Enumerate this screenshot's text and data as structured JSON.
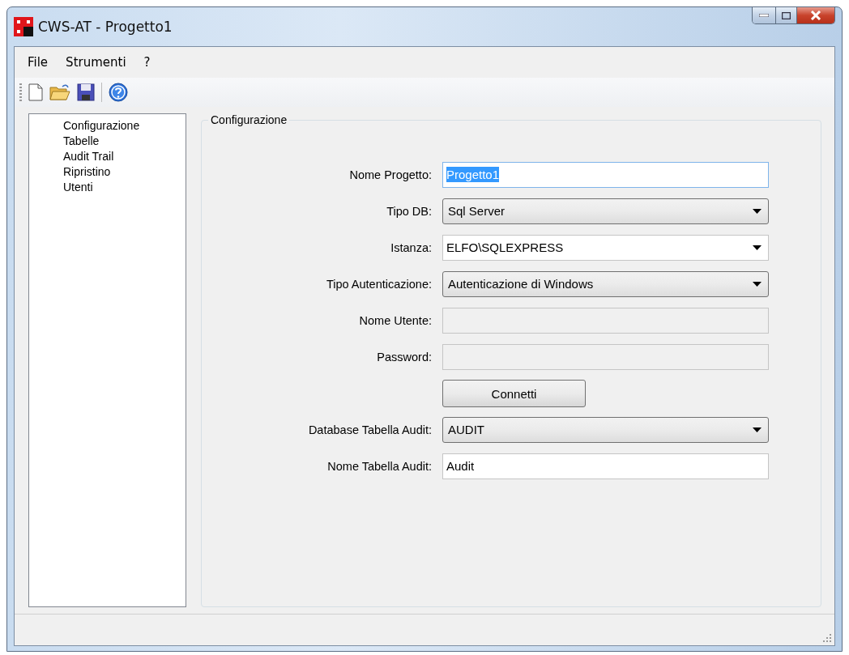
{
  "window": {
    "title": "CWS-AT - Progetto1"
  },
  "menu": [
    "File",
    "Strumenti",
    "?"
  ],
  "toolbar": [
    {
      "kind": "new"
    },
    {
      "kind": "open"
    },
    {
      "kind": "save"
    },
    {
      "kind": "separator"
    },
    {
      "kind": "help"
    }
  ],
  "sidebar": {
    "items": [
      {
        "label": "Configurazione",
        "selected": false
      },
      {
        "label": "Tabelle",
        "selected": false
      },
      {
        "label": "Audit Trail",
        "selected": false
      },
      {
        "label": "Ripristino",
        "selected": false
      },
      {
        "label": "Utenti",
        "selected": false
      }
    ]
  },
  "group": {
    "title": "Configurazione",
    "rows": [
      {
        "kind": "text",
        "label": "Nome Progetto:",
        "value": "Progetto1",
        "highlighted": true,
        "disabled": false
      },
      {
        "kind": "dropdown",
        "label": "Tipo DB:",
        "value": "Sql Server"
      },
      {
        "kind": "combo",
        "label": "Istanza:",
        "value": "ELFO\\SQLEXPRESS"
      },
      {
        "kind": "dropdown",
        "label": "Tipo Autenticazione:",
        "value": "Autenticazione di Windows"
      },
      {
        "kind": "text",
        "label": "Nome Utente:",
        "highlighted": false,
        "disabled": true
      },
      {
        "kind": "text",
        "label": "Password:",
        "highlighted": false,
        "disabled": true
      },
      {
        "kind": "button",
        "value": "Connetti"
      },
      {
        "kind": "dropdown",
        "label": "Database Tabella Audit:",
        "value": "AUDIT"
      },
      {
        "kind": "text",
        "label": "Nome Tabella Audit:",
        "value": "Audit",
        "highlighted": false,
        "disabled": false
      }
    ]
  }
}
